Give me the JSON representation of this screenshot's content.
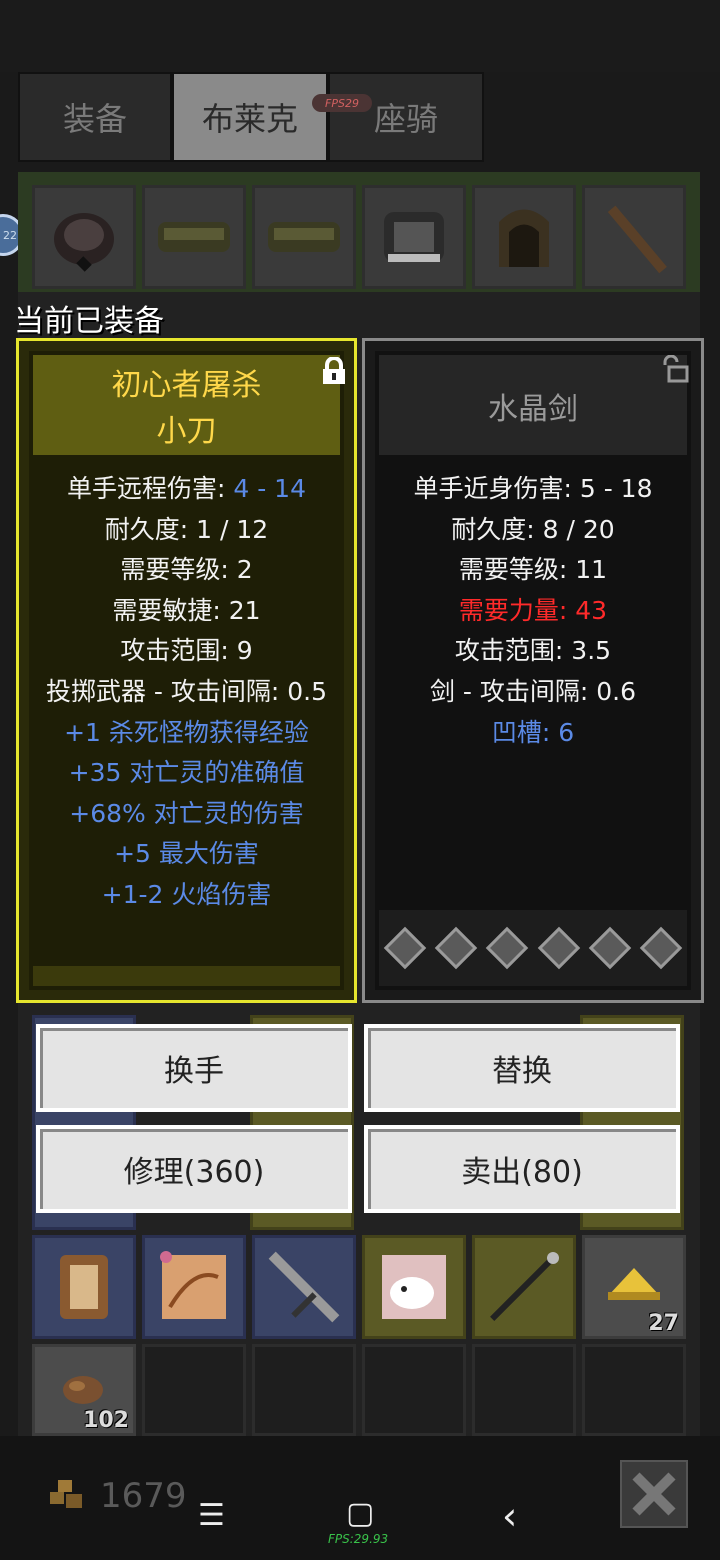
{
  "tabs": [
    {
      "label": "装备",
      "active": false
    },
    {
      "label": "布莱克",
      "active": true
    },
    {
      "label": "座骑",
      "active": false
    }
  ],
  "fps_badge": "FPS29",
  "side_bubble": "22",
  "equipped_label": "当前已装备",
  "left_item": {
    "name_line1": "初心者屠杀",
    "name_line2": "小刀",
    "locked": true,
    "stats": [
      {
        "label": "单手远程伤害: ",
        "value": "4 - 14"
      },
      {
        "text": "耐久度: 1 / 12"
      },
      {
        "text": "需要等级: 2"
      },
      {
        "text": "需要敏捷: 21"
      },
      {
        "text": "攻击范围: 9"
      },
      {
        "text": "投掷武器 - 攻击间隔: 0.5"
      }
    ],
    "bonuses": [
      "+1 杀死怪物获得经验",
      "+35 对亡灵的准确值",
      "+68% 对亡灵的伤害",
      "+5 最大伤害",
      "+1-2 火焰伤害"
    ]
  },
  "right_item": {
    "name": "水晶剑",
    "locked": false,
    "stats": [
      {
        "text": "单手近身伤害: 5 - 18",
        "color": "white"
      },
      {
        "text": "耐久度: 8 / 20",
        "color": "white"
      },
      {
        "text": "需要等级: 11",
        "color": "white"
      },
      {
        "text": "需要力量: 43",
        "color": "red"
      },
      {
        "text": "攻击范围: 3.5",
        "color": "white"
      },
      {
        "text": "剑 - 攻击间隔: 0.6",
        "color": "white"
      },
      {
        "text": "凹槽: 6",
        "color": "blue"
      }
    ],
    "socket_count": 6
  },
  "buttons": {
    "swap_hand": "换手",
    "replace": "替换",
    "repair": "修理(360)",
    "sell": "卖出(80)"
  },
  "inventory": {
    "counts": {
      "cheese": "27",
      "ore": "102"
    }
  },
  "gold": "1679",
  "nav": {
    "menu": "☰",
    "home": "▢",
    "back": "‹"
  },
  "fps_bottom": "FPS:29.93",
  "colors": {
    "accent_yellow": "#e6e62e",
    "stat_blue": "#5b8ae6",
    "stat_red": "#ff2a2a"
  }
}
